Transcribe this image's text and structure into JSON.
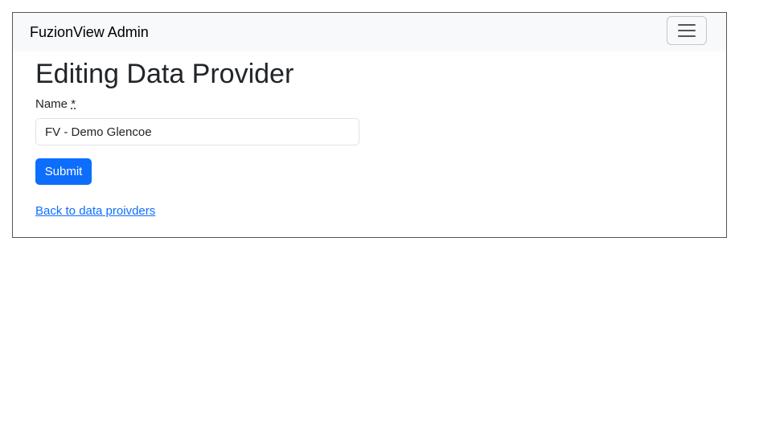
{
  "navbar": {
    "brand": "FuzionView Admin",
    "toggler_icon": "hamburger-menu-icon"
  },
  "page": {
    "title": "Editing Data Provider"
  },
  "form": {
    "name_label": "Name",
    "required_marker": "*",
    "name_value": "FV - Demo Glencoe",
    "submit_label": "Submit"
  },
  "links": {
    "back": "Back to data proivders"
  },
  "colors": {
    "primary": "#0d6efd",
    "navbar_bg": "#f8f9fa"
  }
}
